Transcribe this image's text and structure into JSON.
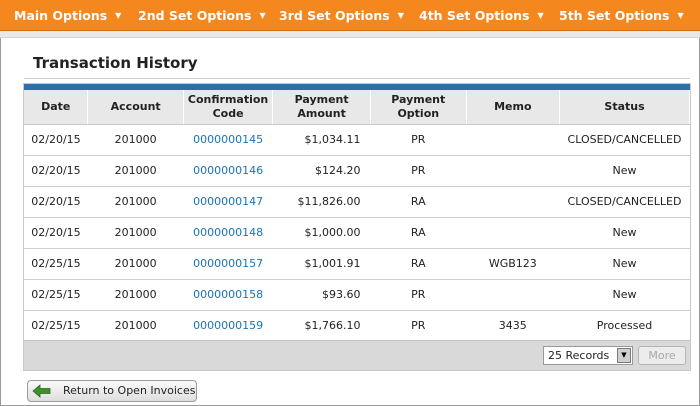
{
  "nav": {
    "items": [
      {
        "label": "Main Options"
      },
      {
        "label": "2nd Set Options"
      },
      {
        "label": "3rd Set Options"
      },
      {
        "label": "4th Set Options"
      },
      {
        "label": "5th Set Options"
      }
    ],
    "chevron": "▼"
  },
  "page": {
    "title": "Transaction History"
  },
  "table": {
    "headers": {
      "date": "Date",
      "account": "Account",
      "confirmation_1": "Confirmation",
      "confirmation_2": "Code",
      "amount_1": "Payment",
      "amount_2": "Amount",
      "option_1": "Payment",
      "option_2": "Option",
      "memo": "Memo",
      "status": "Status"
    },
    "rows": [
      {
        "date": "02/20/15",
        "account": "201000",
        "code": "0000000145",
        "amount": "$1,034.11",
        "option": "PR",
        "memo": "",
        "status": "CLOSED/CANCELLED"
      },
      {
        "date": "02/20/15",
        "account": "201000",
        "code": "0000000146",
        "amount": "$124.20",
        "option": "PR",
        "memo": "",
        "status": "New"
      },
      {
        "date": "02/20/15",
        "account": "201000",
        "code": "0000000147",
        "amount": "$11,826.00",
        "option": "RA",
        "memo": "",
        "status": "CLOSED/CANCELLED"
      },
      {
        "date": "02/20/15",
        "account": "201000",
        "code": "0000000148",
        "amount": "$1,000.00",
        "option": "RA",
        "memo": "",
        "status": "New"
      },
      {
        "date": "02/25/15",
        "account": "201000",
        "code": "0000000157",
        "amount": "$1,001.91",
        "option": "RA",
        "memo": "WGB123",
        "status": "New"
      },
      {
        "date": "02/25/15",
        "account": "201000",
        "code": "0000000158",
        "amount": "$93.60",
        "option": "PR",
        "memo": "",
        "status": "New"
      },
      {
        "date": "02/25/15",
        "account": "201000",
        "code": "0000000159",
        "amount": "$1,766.10",
        "option": "PR",
        "memo": "3435",
        "status": "Processed"
      }
    ]
  },
  "footer": {
    "records_select": "25 Records",
    "more_label": "More"
  },
  "actions": {
    "return_label": "Return to Open Invoices"
  },
  "colors": {
    "nav_bg": "#f5871f",
    "accent_bar": "#2f6fa6",
    "link": "#1a73b8",
    "return_arrow": "#3f8f2e"
  },
  "icons": {
    "return": "left-arrow-icon",
    "select": "dropdown-arrow-icon",
    "nav": "chevron-down-icon"
  }
}
